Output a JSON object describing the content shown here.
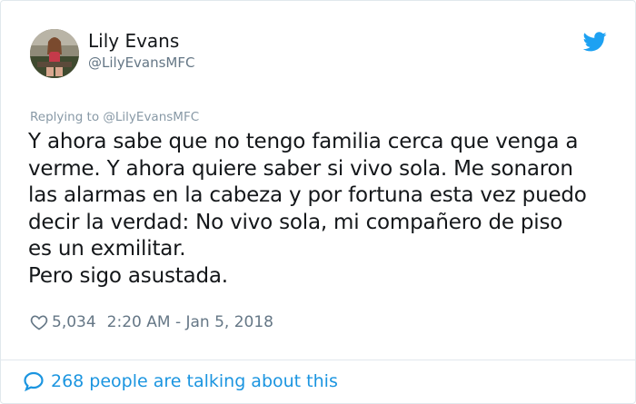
{
  "author": {
    "name": "Lily Evans",
    "handle": "@LilyEvansMFC",
    "avatar_icon": "profile-photo",
    "platform_icon": "twitter-bird-icon"
  },
  "reply": {
    "prefix": "Replying to ",
    "mention": "@LilyEvansMFC"
  },
  "tweet": {
    "lines": [
      "Y ahora sabe que no tengo familia cerca que venga a",
      "verme. Y ahora quiere saber si vivo sola. Me sonaron",
      "las alarmas en la cabeza y por fortuna esta vez puedo",
      "decir la verdad: No vivo sola, mi compañero de piso",
      "es un exmilitar.",
      "Pero sigo asustada."
    ]
  },
  "meta": {
    "likes": "5,034",
    "timestamp": "2:20 AM - Jan 5, 2018",
    "heart_icon": "heart-outline-icon"
  },
  "footer": {
    "talking_text": "268 people are talking about this",
    "bubble_icon": "speech-bubble-icon"
  },
  "colors": {
    "link_blue": "#1b95e0",
    "twitter_blue": "#1da1f2",
    "muted": "#657786",
    "text": "#14171a",
    "border": "#e1e8ed"
  }
}
